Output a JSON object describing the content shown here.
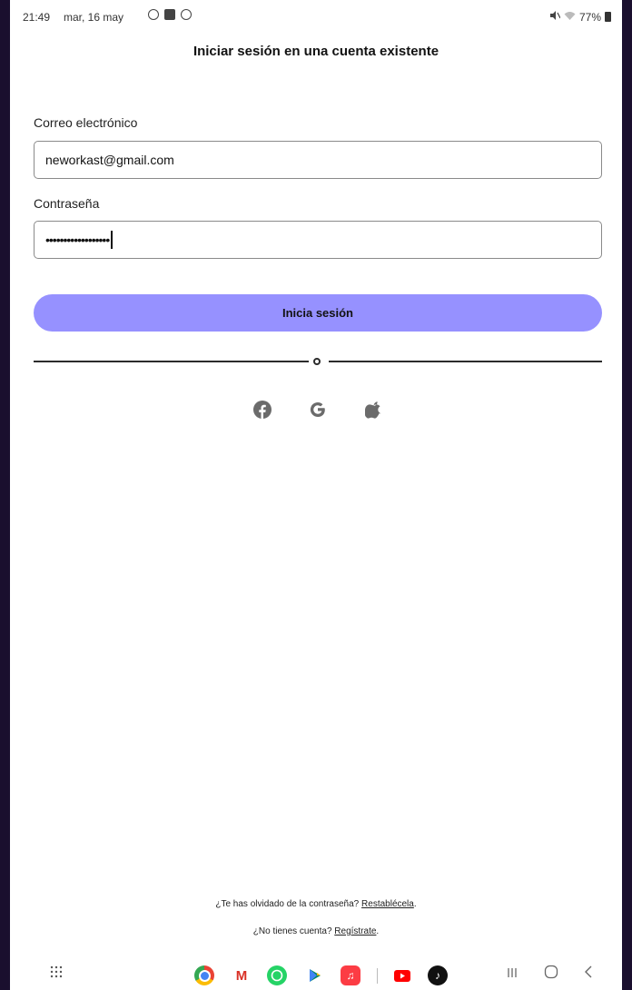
{
  "status_bar": {
    "time": "21:49",
    "date": "mar, 16 may",
    "battery": "77%"
  },
  "page": {
    "title": "Iniciar sesión en una cuenta existente"
  },
  "form": {
    "email_label": "Correo electrónico",
    "email_value": "neworkast@gmail.com",
    "password_label": "Contraseña",
    "password_value": "••••••••••••••••••",
    "submit_label": "Inicia sesión"
  },
  "social_login": [
    {
      "icon": "facebook-icon"
    },
    {
      "icon": "google-icon"
    },
    {
      "icon": "apple-icon"
    }
  ],
  "footer": {
    "forgot_text": "¿Te has olvidado de la contraseña?",
    "forgot_link": "Restablécela",
    "forgot_end": ".",
    "signup_text": "¿No tienes cuenta?",
    "signup_link": "Regístrate",
    "signup_end": "."
  },
  "taskbar": {
    "apps": [
      "chrome-icon",
      "gmail-icon",
      "whatsapp-icon",
      "play-store-icon",
      "music-icon",
      "youtube-icon",
      "tiktok-icon"
    ],
    "accent": "#9691ff"
  }
}
